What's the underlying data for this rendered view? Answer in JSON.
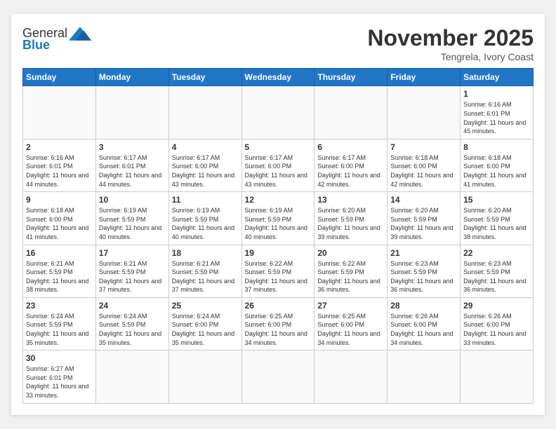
{
  "header": {
    "logo_general": "General",
    "logo_blue": "Blue",
    "month": "November 2025",
    "location": "Tengrela, Ivory Coast"
  },
  "weekdays": [
    "Sunday",
    "Monday",
    "Tuesday",
    "Wednesday",
    "Thursday",
    "Friday",
    "Saturday"
  ],
  "days": {
    "1": {
      "sunrise": "6:16 AM",
      "sunset": "6:01 PM",
      "daylight": "11 hours and 45 minutes."
    },
    "2": {
      "sunrise": "6:16 AM",
      "sunset": "6:01 PM",
      "daylight": "11 hours and 44 minutes."
    },
    "3": {
      "sunrise": "6:17 AM",
      "sunset": "6:01 PM",
      "daylight": "11 hours and 44 minutes."
    },
    "4": {
      "sunrise": "6:17 AM",
      "sunset": "6:00 PM",
      "daylight": "11 hours and 43 minutes."
    },
    "5": {
      "sunrise": "6:17 AM",
      "sunset": "6:00 PM",
      "daylight": "11 hours and 43 minutes."
    },
    "6": {
      "sunrise": "6:17 AM",
      "sunset": "6:00 PM",
      "daylight": "11 hours and 42 minutes."
    },
    "7": {
      "sunrise": "6:18 AM",
      "sunset": "6:00 PM",
      "daylight": "11 hours and 42 minutes."
    },
    "8": {
      "sunrise": "6:18 AM",
      "sunset": "6:00 PM",
      "daylight": "11 hours and 41 minutes."
    },
    "9": {
      "sunrise": "6:18 AM",
      "sunset": "6:00 PM",
      "daylight": "11 hours and 41 minutes."
    },
    "10": {
      "sunrise": "6:19 AM",
      "sunset": "5:59 PM",
      "daylight": "11 hours and 40 minutes."
    },
    "11": {
      "sunrise": "6:19 AM",
      "sunset": "5:59 PM",
      "daylight": "11 hours and 40 minutes."
    },
    "12": {
      "sunrise": "6:19 AM",
      "sunset": "5:59 PM",
      "daylight": "11 hours and 40 minutes."
    },
    "13": {
      "sunrise": "6:20 AM",
      "sunset": "5:59 PM",
      "daylight": "11 hours and 39 minutes."
    },
    "14": {
      "sunrise": "6:20 AM",
      "sunset": "5:59 PM",
      "daylight": "11 hours and 39 minutes."
    },
    "15": {
      "sunrise": "6:20 AM",
      "sunset": "5:59 PM",
      "daylight": "11 hours and 38 minutes."
    },
    "16": {
      "sunrise": "6:21 AM",
      "sunset": "5:59 PM",
      "daylight": "11 hours and 38 minutes."
    },
    "17": {
      "sunrise": "6:21 AM",
      "sunset": "5:59 PM",
      "daylight": "11 hours and 37 minutes."
    },
    "18": {
      "sunrise": "6:21 AM",
      "sunset": "5:59 PM",
      "daylight": "11 hours and 37 minutes."
    },
    "19": {
      "sunrise": "6:22 AM",
      "sunset": "5:59 PM",
      "daylight": "11 hours and 37 minutes."
    },
    "20": {
      "sunrise": "6:22 AM",
      "sunset": "5:59 PM",
      "daylight": "11 hours and 36 minutes."
    },
    "21": {
      "sunrise": "6:23 AM",
      "sunset": "5:59 PM",
      "daylight": "11 hours and 36 minutes."
    },
    "22": {
      "sunrise": "6:23 AM",
      "sunset": "5:59 PM",
      "daylight": "11 hours and 36 minutes."
    },
    "23": {
      "sunrise": "6:24 AM",
      "sunset": "5:59 PM",
      "daylight": "11 hours and 35 minutes."
    },
    "24": {
      "sunrise": "6:24 AM",
      "sunset": "5:59 PM",
      "daylight": "11 hours and 35 minutes."
    },
    "25": {
      "sunrise": "6:24 AM",
      "sunset": "6:00 PM",
      "daylight": "11 hours and 35 minutes."
    },
    "26": {
      "sunrise": "6:25 AM",
      "sunset": "6:00 PM",
      "daylight": "11 hours and 34 minutes."
    },
    "27": {
      "sunrise": "6:25 AM",
      "sunset": "6:00 PM",
      "daylight": "11 hours and 34 minutes."
    },
    "28": {
      "sunrise": "6:26 AM",
      "sunset": "6:00 PM",
      "daylight": "11 hours and 34 minutes."
    },
    "29": {
      "sunrise": "6:26 AM",
      "sunset": "6:00 PM",
      "daylight": "11 hours and 33 minutes."
    },
    "30": {
      "sunrise": "6:27 AM",
      "sunset": "6:01 PM",
      "daylight": "11 hours and 33 minutes."
    }
  },
  "labels": {
    "sunrise": "Sunrise: ",
    "sunset": "Sunset: ",
    "daylight": "Daylight: "
  }
}
